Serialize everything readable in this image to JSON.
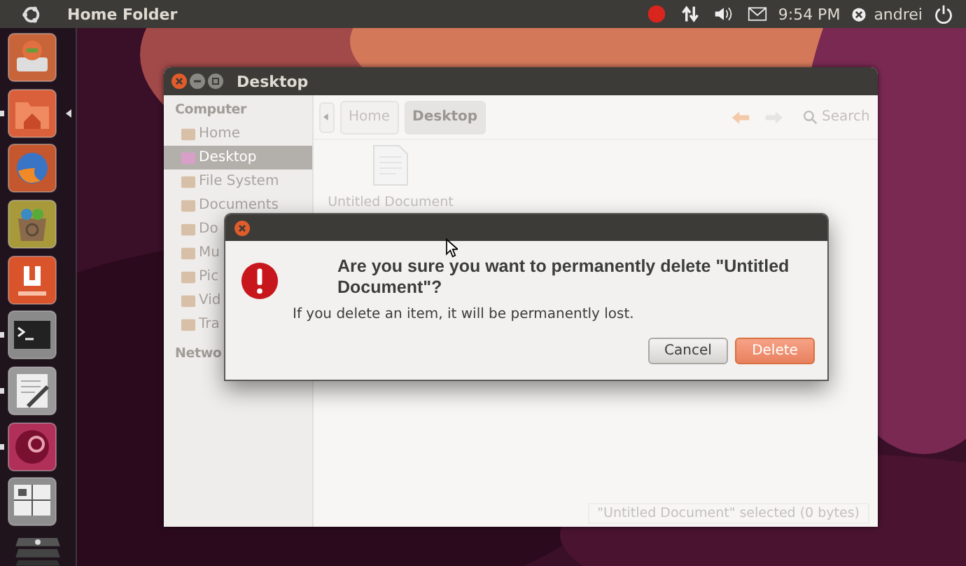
{
  "top_panel": {
    "app_title": "Home Folder",
    "clock": "9:54 PM",
    "user": "andrei"
  },
  "launcher": {
    "items": [
      {
        "kind": "drive",
        "color": "#c8643a",
        "running": false,
        "active": false
      },
      {
        "kind": "folder",
        "color": "#d9603b",
        "running": true,
        "active": true
      },
      {
        "kind": "browser",
        "color": "#c4572e",
        "running": false,
        "active": false
      },
      {
        "kind": "bag",
        "color": "#a89a3a",
        "running": false,
        "active": false
      },
      {
        "kind": "letter",
        "color": "#d9532b",
        "running": false,
        "active": false
      },
      {
        "kind": "terminal",
        "color": "#8a8a8a",
        "running": true,
        "active": false
      },
      {
        "kind": "editor",
        "color": "#9a9a9a",
        "running": true,
        "active": false
      },
      {
        "kind": "swirl",
        "color": "#b0305a",
        "running": true,
        "active": false
      },
      {
        "kind": "workspaces",
        "color": "#8e8e8e",
        "running": false,
        "active": false
      }
    ]
  },
  "file_manager": {
    "title": "Desktop",
    "sidebar": [
      {
        "heading": "Computer",
        "items": [
          {
            "label": "Home",
            "selected": false
          },
          {
            "label": "Desktop",
            "selected": true
          },
          {
            "label": "File System",
            "selected": false
          },
          {
            "label": "Documents",
            "selected": false
          },
          {
            "label": "Do",
            "selected": false
          },
          {
            "label": "Mu",
            "selected": false
          },
          {
            "label": "Pic",
            "selected": false
          },
          {
            "label": "Vid",
            "selected": false
          },
          {
            "label": "Tra",
            "selected": false
          }
        ]
      },
      {
        "heading": "Netwo"
      }
    ],
    "path": [
      {
        "label": "Home",
        "selected": false
      },
      {
        "label": "Desktop",
        "selected": true
      }
    ],
    "search": {
      "placeholder": "Search"
    },
    "files": [
      {
        "name": "Untitled Document"
      }
    ],
    "status_bar": "\"Untitled Document\" selected (0 bytes)"
  },
  "dialog": {
    "heading": "Are you sure you want to permanently delete \"Untitled Document\"?",
    "message": "If you delete an item, it will be permanently lost.",
    "buttons": [
      {
        "label": "Cancel",
        "kind": "normal"
      },
      {
        "label": "Delete",
        "kind": "destructive"
      }
    ]
  }
}
